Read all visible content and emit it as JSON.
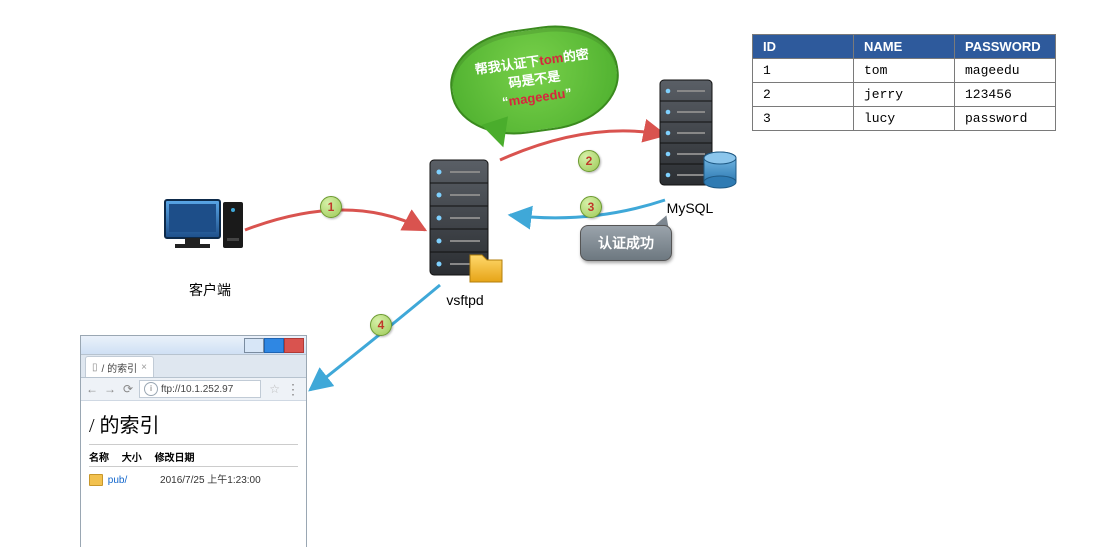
{
  "nodes": {
    "client_label": "客户端",
    "server_label": "vsftpd",
    "db_label": "MySQL"
  },
  "steps": {
    "s1": "1",
    "s2": "2",
    "s3": "3",
    "s4": "4"
  },
  "bubble": {
    "line1_pre": "帮我认证下",
    "line1_user": "tom",
    "line1_post": "的密",
    "line2": "码是不是",
    "line3_quote": "“",
    "line3_pass": "mageedu",
    "line3_end": "”"
  },
  "callout": {
    "text": "认证成功"
  },
  "db_table": {
    "headers": {
      "id": "ID",
      "name": "NAME",
      "password": "PASSWORD"
    },
    "rows": [
      {
        "id": "1",
        "name": "tom",
        "password": "mageedu"
      },
      {
        "id": "2",
        "name": "jerry",
        "password": "123456"
      },
      {
        "id": "3",
        "name": "lucy",
        "password": "password"
      }
    ]
  },
  "browser": {
    "tab_title": "/ 的索引",
    "url": "ftp://10.1.252.97",
    "page_heading": "/ 的索引",
    "col_name": "名称",
    "col_size": "大小",
    "col_date": "修改日期",
    "entry_name": "pub/",
    "entry_date": "2016/7/25 上午1:23:00"
  }
}
